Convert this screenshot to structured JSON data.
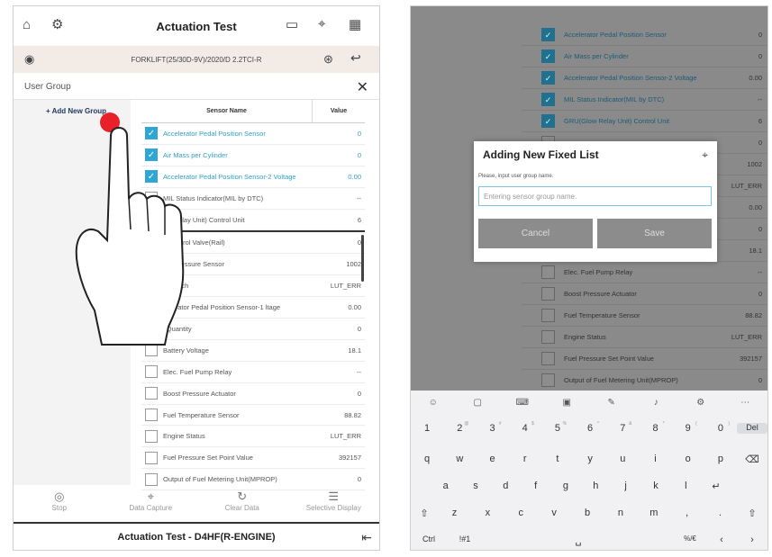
{
  "left": {
    "title": "Actuation Test",
    "vehicle": "FORKLIFT(25/30D-9V)/2020/D 2.2TCI-R",
    "user_group_label": "User Group",
    "add_group": "+ Add New Group",
    "header": {
      "sensor_name": "Sensor Name",
      "value": "Value"
    },
    "rows": [
      {
        "name": "Accelerator Pedal Position Sensor",
        "value": "0",
        "checked": true
      },
      {
        "name": "Air Mass per Cylinder",
        "value": "0",
        "checked": true
      },
      {
        "name": "Accelerator Pedal Position Sensor-2 Voltage",
        "value": "0.00",
        "checked": true
      },
      {
        "name": "MIL Status Indicator(MIL by DTC)",
        "value": "--",
        "checked": false
      },
      {
        "name": "ow Relay Unit) Control Unit",
        "value": "6",
        "checked": false
      },
      {
        "name": "e Control Valve(Rail)",
        "value": "0",
        "checked": false
      },
      {
        "name": "tric Pressure Sensor",
        "value": "1002",
        "checked": false
      },
      {
        "name": "n Switch",
        "value": "LUT_ERR",
        "checked": false
      },
      {
        "name": "celerator Pedal Position Sensor-1 ltage",
        "value": "0.00",
        "checked": false
      },
      {
        "name": "l Quantity",
        "value": "0",
        "checked": false
      },
      {
        "name": "Battery Voltage",
        "value": "18.1",
        "checked": false
      },
      {
        "name": "Elec. Fuel Pump Relay",
        "value": "--",
        "checked": false
      },
      {
        "name": "Boost Pressure Actuator",
        "value": "0",
        "checked": false
      },
      {
        "name": "Fuel Temperature Sensor",
        "value": "88.82",
        "checked": false
      },
      {
        "name": "Engine Status",
        "value": "LUT_ERR",
        "checked": false
      },
      {
        "name": "Fuel Pressure Set Point Value",
        "value": "392157",
        "checked": false
      },
      {
        "name": "Output of Fuel Metering Unit(MPROP)",
        "value": "0",
        "checked": false
      }
    ],
    "bottom_buttons": [
      "Stop",
      "Data Capture",
      "Clear Data",
      "Selective Display"
    ],
    "footer": "Actuation Test  - D4HF(R-ENGINE)"
  },
  "right": {
    "rows": [
      {
        "name": "Accelerator Pedal Position Sensor",
        "value": "0",
        "checked": true
      },
      {
        "name": "Air Mass per Cylinder",
        "value": "0",
        "checked": true
      },
      {
        "name": "Accelerator Pedal Position Sensor-2 Voltage",
        "value": "0.00",
        "checked": true
      },
      {
        "name": "MIL Status Indicator(MIL by DTC)",
        "value": "--",
        "checked": true
      },
      {
        "name": "GRU(Glow Relay Unit) Control Unit",
        "value": "6",
        "checked": true
      },
      {
        "name": "",
        "value": "0",
        "checked": false
      },
      {
        "name": "",
        "value": "1002",
        "checked": false
      },
      {
        "name": "",
        "value": "LUT_ERR",
        "checked": false
      },
      {
        "name": "",
        "value": "0.00",
        "checked": false
      },
      {
        "name": "",
        "value": "0",
        "checked": false
      },
      {
        "name": "",
        "value": "18.1",
        "checked": false
      },
      {
        "name": "Elec. Fuel Pump Relay",
        "value": "--",
        "checked": false
      },
      {
        "name": "Boost Pressure Actuator",
        "value": "0",
        "checked": false
      },
      {
        "name": "Fuel Temperature Sensor",
        "value": "88.82",
        "checked": false
      },
      {
        "name": "Engine Status",
        "value": "LUT_ERR",
        "checked": false
      },
      {
        "name": "Fuel Pressure Set Point Value",
        "value": "392157",
        "checked": false
      },
      {
        "name": "Output of Fuel Metering Unit(MPROP)",
        "value": "0",
        "checked": false
      }
    ],
    "dialog": {
      "title": "Adding New Fixed List",
      "prompt": "Please, input user group name.",
      "placeholder": "Entering sensor group name.",
      "cancel": "Cancel",
      "save": "Save"
    },
    "keyboard": {
      "numbers": [
        [
          "1",
          ""
        ],
        [
          "2",
          "@"
        ],
        [
          "3",
          "#"
        ],
        [
          "4",
          "$"
        ],
        [
          "5",
          "%"
        ],
        [
          "6",
          "^"
        ],
        [
          "7",
          "&"
        ],
        [
          "8",
          "*"
        ],
        [
          "9",
          "("
        ],
        [
          "0",
          ")"
        ]
      ],
      "del": "Del",
      "row_q": [
        "q",
        "w",
        "e",
        "r",
        "t",
        "y",
        "u",
        "i",
        "o",
        "p"
      ],
      "row_a": [
        "a",
        "s",
        "d",
        "f",
        "g",
        "h",
        "j",
        "k",
        "l"
      ],
      "row_z": [
        "z",
        "x",
        "c",
        "v",
        "b",
        "n",
        "m",
        ",",
        "."
      ],
      "ctrl": "Ctrl",
      "sym": "!#1",
      "lang": "%/€"
    }
  }
}
